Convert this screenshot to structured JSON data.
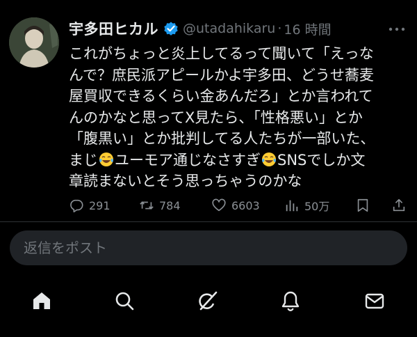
{
  "tweet": {
    "display_name": "宇多田ヒカル",
    "handle": "@utadahikaru",
    "separator": "·",
    "time": "16 時間",
    "lines": [
      "これがちょっと炎上してるって聞いて「えっな",
      "んで？庶民派アピールかよ宇多田、どうせ蕎麦",
      "屋買収できるくらい金あんだろ」とか言われて",
      "んのかなと思ってX見たら、「性格悪い」とか",
      "「腹黒い」とか批判してる人たちが一部いた、",
      "SNSでしか文",
      "章読まないとそう思っちゃうのかな"
    ],
    "line6_parts": [
      "まじ",
      "ユーモア通じなさすぎ"
    ],
    "emoji_name": "face-with-tears-of-joy"
  },
  "actions": {
    "replies": "291",
    "reposts": "784",
    "likes": "6603",
    "views": "50万"
  },
  "reply": {
    "placeholder": "返信をポスト"
  },
  "colors": {
    "background": "#000000",
    "text": "#e7e9ea",
    "muted": "#71767b",
    "verified": "#1d9bf0",
    "reply_box": "#202327"
  },
  "tabbar": {
    "items": [
      "home-icon",
      "search-icon",
      "grok-icon",
      "notifications-icon",
      "messages-icon"
    ]
  }
}
